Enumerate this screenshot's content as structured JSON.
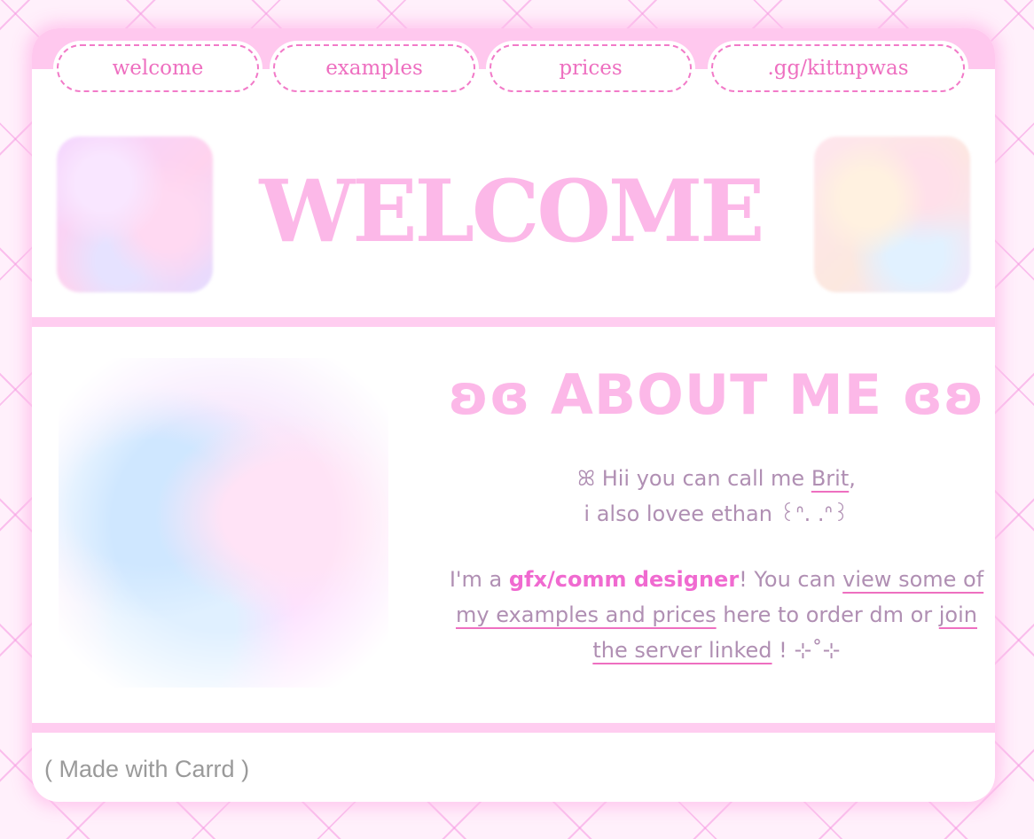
{
  "nav": {
    "items": [
      {
        "label": "welcome"
      },
      {
        "label": "examples"
      },
      {
        "label": "prices"
      },
      {
        "label": ".gg/kittnpwas"
      }
    ]
  },
  "header": {
    "title": "WELCOME"
  },
  "about": {
    "title": "ʚɞ ABOUT ME ɞʚ",
    "intro": {
      "line1_prefix": "ꕤ Hii you can call me ",
      "name": "Brit",
      "line1_suffix": ",",
      "line2": "i also lovee ethan ꒰ᐢ. .ᐢ꒱"
    },
    "desc": {
      "part1": "I'm a ",
      "highlight": "gfx/comm designer",
      "part2": "! You can ",
      "link1": "view some of my examples and prices",
      "part3": " here to order dm or ",
      "link2": "join the server linked",
      "part4": " ! ⊹˚⊹"
    }
  },
  "footer": {
    "label": "( Made with Carrd )"
  },
  "colors": {
    "accent": "#ee6fc0",
    "title_pink": "#fcb8e8",
    "bar_pink": "#ffc8ee",
    "body_text": "#b08fb3"
  }
}
